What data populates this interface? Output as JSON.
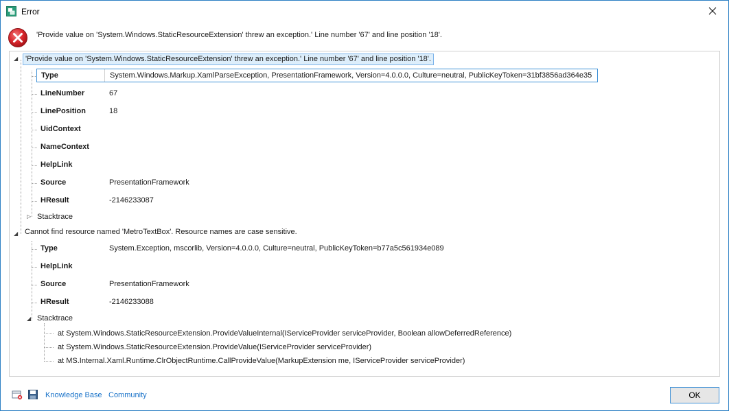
{
  "window": {
    "title": "Error",
    "close_icon": "close-icon"
  },
  "header": {
    "message": "'Provide value on 'System.Windows.StaticResourceExtension' threw an exception.' Line number '67' and line position '18'."
  },
  "tree": {
    "exception1": {
      "label": "'Provide value on 'System.Windows.StaticResourceExtension' threw an exception.' Line number '67' and line position '18'.",
      "expanded": true,
      "properties": [
        {
          "key": "Type",
          "value": "System.Windows.Markup.XamlParseException, PresentationFramework, Version=4.0.0.0, Culture=neutral, PublicKeyToken=31bf3856ad364e35"
        },
        {
          "key": "LineNumber",
          "value": "67"
        },
        {
          "key": "LinePosition",
          "value": "18"
        },
        {
          "key": "UidContext",
          "value": ""
        },
        {
          "key": "NameContext",
          "value": ""
        },
        {
          "key": "HelpLink",
          "value": ""
        },
        {
          "key": "Source",
          "value": "PresentationFramework"
        },
        {
          "key": "HResult",
          "value": "-2146233087"
        }
      ],
      "stacktrace_label": "Stacktrace"
    },
    "exception2": {
      "label": "Cannot find resource named 'MetroTextBox'. Resource names are case sensitive.",
      "expanded": true,
      "properties": [
        {
          "key": "Type",
          "value": "System.Exception, mscorlib, Version=4.0.0.0, Culture=neutral, PublicKeyToken=b77a5c561934e089"
        },
        {
          "key": "HelpLink",
          "value": ""
        },
        {
          "key": "Source",
          "value": "PresentationFramework"
        },
        {
          "key": "HResult",
          "value": "-2146233088"
        }
      ],
      "stacktrace_label": "Stacktrace",
      "stacktrace_lines": [
        "at System.Windows.StaticResourceExtension.ProvideValueInternal(IServiceProvider serviceProvider, Boolean allowDeferredReference)",
        "at System.Windows.StaticResourceExtension.ProvideValue(IServiceProvider serviceProvider)",
        "at MS.Internal.Xaml.Runtime.ClrObjectRuntime.CallProvideValue(MarkupExtension me, IServiceProvider serviceProvider)"
      ]
    }
  },
  "footer": {
    "knowledge_base": "Knowledge Base",
    "community": "Community",
    "ok": "OK"
  },
  "colors": {
    "accent": "#2b7fc4",
    "link": "#1a73c9",
    "error_red": "#d9262c"
  }
}
